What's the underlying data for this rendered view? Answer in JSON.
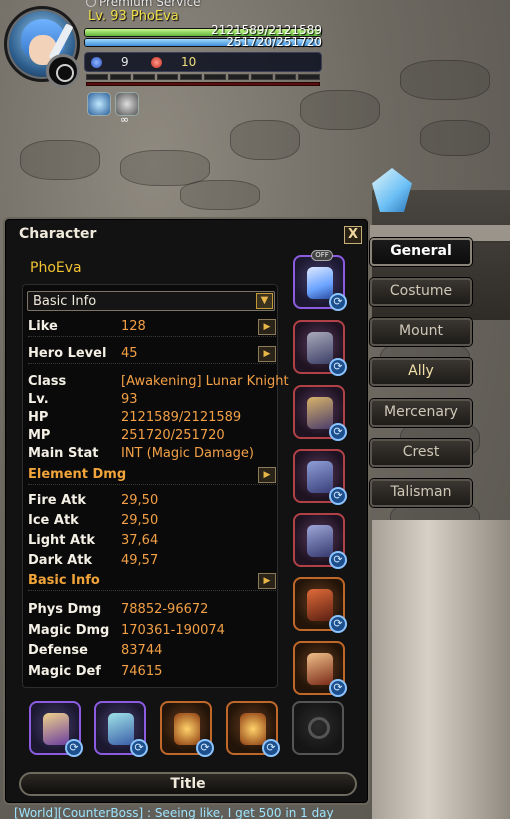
{
  "hud": {
    "premium_label": "Premium Service",
    "level_name": "Lv. 93 PhoEva",
    "hp_text": "2121589/2121589",
    "mp_text": "251720/251720",
    "hp_fill": 1.0,
    "mp_fill": 1.0,
    "stat_a_icon": "blue-heart-icon",
    "stat_a_value": "9",
    "stat_b_icon": "red-heart-icon",
    "stat_b_value": "10",
    "buff_count": "∞",
    "buff_icons": [
      "ice-buff-icon",
      "skull-buff-icon"
    ]
  },
  "window": {
    "title": "Character",
    "close_label": "X",
    "character_name": "PhoEva",
    "dropdown_value": "Basic Info",
    "rows": [
      {
        "label": "Like",
        "value": "128"
      },
      {
        "label": "Hero Level",
        "value": "45"
      }
    ],
    "info": [
      {
        "label": "Class",
        "value": "[Awakening] Lunar Knight"
      },
      {
        "label": "Lv.",
        "value": "93"
      },
      {
        "label": "HP",
        "value": "2121589/2121589"
      },
      {
        "label": "MP",
        "value": "251720/251720"
      },
      {
        "label": "Main Stat",
        "value": "INT (Magic Damage)"
      }
    ],
    "element_header": "Element Dmg",
    "elements": [
      {
        "label": "Fire Atk",
        "value": "29,50"
      },
      {
        "label": "Ice Atk",
        "value": "29,50"
      },
      {
        "label": "Light Atk",
        "value": "37,64"
      },
      {
        "label": "Dark Atk",
        "value": "49,57"
      }
    ],
    "basic_header": "Basic Info",
    "basic": [
      {
        "label": "Phys Dmg",
        "value": "78852-96672"
      },
      {
        "label": "Magic Dmg",
        "value": "170361-190074"
      },
      {
        "label": "Defense",
        "value": "83744"
      },
      {
        "label": "Magic Def",
        "value": "74615"
      }
    ],
    "equipment_right": [
      {
        "name": "weapon-equip-slot",
        "off_badge": "OFF",
        "color": "#6d5cb3"
      },
      {
        "name": "helmet-equip-slot",
        "color": "#b04146"
      },
      {
        "name": "armor-equip-slot",
        "color": "#b04146"
      },
      {
        "name": "gloves-equip-slot",
        "color": "#b04146"
      },
      {
        "name": "boots-equip-slot",
        "color": "#b04146"
      },
      {
        "name": "offhand-equip-slot",
        "color": "#c0682a"
      },
      {
        "name": "accessory-equip-slot",
        "color": "#c0682a"
      }
    ],
    "equipment_bottom": [
      {
        "name": "necklace-equip-slot",
        "color": "#8c5ce0"
      },
      {
        "name": "earring-equip-slot",
        "color": "#8c5ce0"
      },
      {
        "name": "ring1-equip-slot",
        "color": "#c0682a"
      },
      {
        "name": "ring2-equip-slot",
        "color": "#c0682a"
      },
      {
        "name": "empty-equip-slot",
        "color": "#555555"
      }
    ],
    "title_button": "Title"
  },
  "tabs": [
    {
      "label": "General",
      "active": true
    },
    {
      "label": "Costume"
    },
    {
      "label": "Mount"
    },
    {
      "label": "Ally"
    },
    {
      "label": "Mercenary"
    },
    {
      "label": "Crest"
    },
    {
      "label": "Talisman"
    }
  ],
  "chat": {
    "line": "[World][CounterBoss] : Seeing like, I get 500 in 1 day"
  },
  "colors": {
    "accent_gold": "#f1c232",
    "stat_value_orange": "#f3a046",
    "sync_blue": "#1d4f8c"
  }
}
